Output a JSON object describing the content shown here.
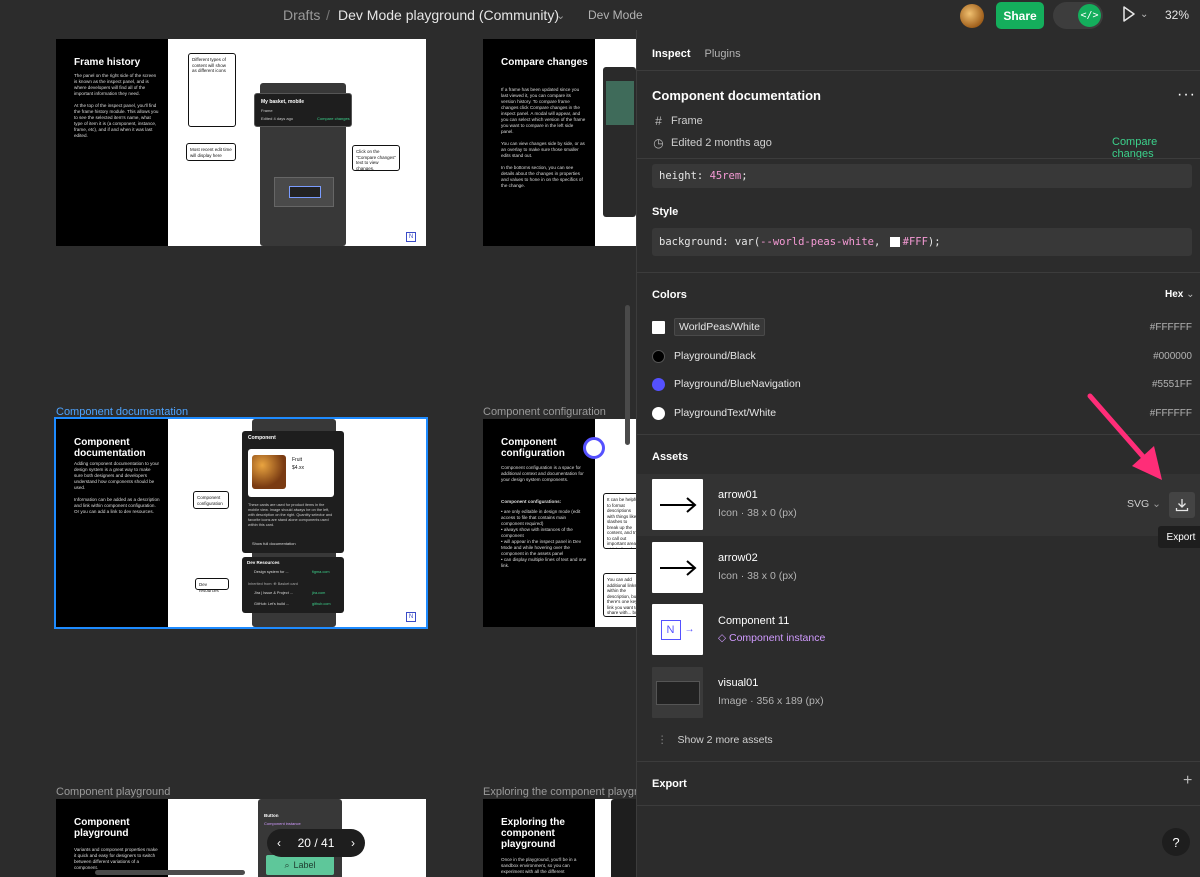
{
  "topbar": {
    "breadcrumb_root": "Drafts",
    "separator": "/",
    "file_name": "Dev Mode playground (Community)",
    "mode_label": "Dev Mode",
    "share_label": "Share",
    "devmode_icon": "</>",
    "zoom": "32%"
  },
  "canvas": {
    "frames": [
      {
        "label": "",
        "title": "Frame history",
        "body": "The panel on the right side of the screen is known as the inspect panel, and is where developers will find all of the important information they need.\n\nAt the top of the inspect panel, you'll find the frame history module. This allows you to see the selected item's name, what type of item it is (a component, instance, frame, etc), and if and when it was last edited.",
        "note1": "Different types of content will show as different icons",
        "note2": "Most recent edit time will display here",
        "note3": "Click on the \"Compare changes\" text to view changes.",
        "card_title": "My basket, mobile",
        "card_sub1": "Frame",
        "card_sub2": "Edited 4 days ago",
        "card_link": "Compare changes"
      },
      {
        "label": "",
        "title": "Compare changes",
        "body": "If a frame has been updated since you last viewed it, you can compare its version history. To compare frame changes click Compare changes in the inspect panel. A modal will appear, and you can select which version of the frame you want to compare in the left side panel.\n\nYou can view changes side by side, or as an overlay to make sure those smaller edits stand out.\n\nIn the bottoms section, you can see details about the changes in properties and values to hone in on the specifics of the change."
      },
      {
        "label": "Component documentation",
        "title": "Component documentation",
        "body": "Adding component documentation to your design system is a great way to make sure both designers and developers understand how components should be used.\n\nInformation can be added as a description and link within component configuration. Or you can add a link to dev resources.",
        "note1": "Component configuration",
        "note2": "Dev resources",
        "card_title": "Component",
        "card_product": "Fruit",
        "card_price": "$4.xx",
        "card_desc": "These cards are used for product items in the mobile view. Image should always be on the left, with description on the right. Quantity selector and favorite icons are stand alone components used within this card.",
        "card_link": "Show full documentation",
        "res_title": "Dev Resources",
        "res_items": [
          "Design system for ...",
          "Inherited from: ⊕ Basket card",
          "Jira | Issue & Project ...",
          "GitHub: Let's build ..."
        ],
        "res_domains": [
          "figma.com",
          "jira.com",
          "github.com"
        ]
      },
      {
        "label": "Component configuration",
        "title": "Component configuration",
        "body": "Component configuration is a space for additional context and documentation for your design system components.",
        "body2": "Component configurations:",
        "bullets": "• are only editable in design mode (edit access to file that contains main component required)\n• always show with instances of the component\n• will appear in the inspect panel in Dev Mode and while hovering over the component in the assets panel\n• can display multiple lines of text and one link.",
        "note1": "It can be helpful to format descriptions with things like slashes to break up the content, and try to call out important areas with bullets for lists.",
        "note2": "You can add additional links within the description, but there's one key link you want to share with... but we suggest putting it here."
      },
      {
        "label": "Component playground",
        "title": "Component playground",
        "body": "Variants and component properties make it quick and easy for designers to switch between different variations of a component.",
        "card_title": "Button",
        "card_sub": "Component instance",
        "button_label": "Label"
      },
      {
        "label": "Exploring the component playgro",
        "title": "Exploring the component playground",
        "body": "Once in the playground, you'll be in a sandbox environment, so you can experiment with all the different"
      }
    ],
    "pager": {
      "current": "20",
      "total": "41",
      "sep": "/"
    }
  },
  "panel": {
    "tabs": [
      {
        "label": "Inspect",
        "active": true
      },
      {
        "label": "Plugins",
        "active": false
      }
    ],
    "header": {
      "title": "Component documentation",
      "type": "Frame",
      "edited": "Edited 2 months ago",
      "compare": "Compare changes"
    },
    "layout_code": {
      "prop": "height:",
      "value": "45rem",
      "end": ";"
    },
    "style": {
      "title": "Style",
      "prop": "background:",
      "fn_open": "var(",
      "token": "--world-peas-white",
      "comma": ",",
      "fallback": "#FFF",
      "fn_close": ");"
    },
    "colors": {
      "title": "Colors",
      "format": "Hex",
      "items": [
        {
          "name": "WorldPeas/White",
          "hex": "#FFFFFF",
          "swatch": "#FFFFFF"
        },
        {
          "name": "Playground/Black",
          "hex": "#000000",
          "swatch": "#000000"
        },
        {
          "name": "Playground/BlueNavigation",
          "hex": "#5551FF",
          "swatch": "#5551FF"
        },
        {
          "name": "PlaygroundText/White",
          "hex": "#FFFFFF",
          "swatch": "#FFFFFF"
        }
      ]
    },
    "assets": {
      "title": "Assets",
      "items": [
        {
          "name": "arrow01",
          "sub": "Icon · 38 x 0 (px)"
        },
        {
          "name": "arrow02",
          "sub": "Icon · 38 x 0 (px)"
        },
        {
          "name": "Component 11",
          "sub": "Component instance"
        },
        {
          "name": "visual01",
          "sub": "Image · 356 x 189 (px)"
        }
      ],
      "format": "SVG",
      "export_tooltip": "Export",
      "more": "Show 2 more assets"
    },
    "export": {
      "title": "Export"
    },
    "help": "?"
  },
  "colors": {
    "accent_green": "#14AE5C",
    "link_green": "#3CD28C",
    "selection_blue": "#1E8BFF",
    "annotation_pink": "#FF2D78",
    "instance_purple": "#D19BFF"
  }
}
